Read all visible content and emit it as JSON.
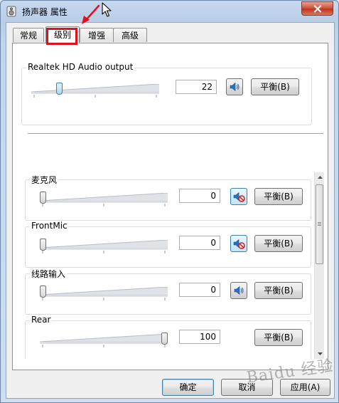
{
  "window": {
    "title": "扬声器 属性"
  },
  "tabs": [
    {
      "label": "常规"
    },
    {
      "label": "级别"
    },
    {
      "label": "增强"
    },
    {
      "label": "高级"
    }
  ],
  "main_output": {
    "name": "Realtek HD Audio output",
    "value": "22",
    "level": 0.22,
    "balance_label": "平衡(B)"
  },
  "channels": [
    {
      "name": "麦克风",
      "value": "0",
      "level": 0,
      "muted": true,
      "balance_label": "平衡(B)"
    },
    {
      "name": "FrontMic",
      "value": "0",
      "level": 0,
      "muted": true,
      "balance_label": "平衡(B)"
    },
    {
      "name": "线路输入",
      "value": "0",
      "level": 0,
      "muted": false,
      "balance_label": "平衡(B)"
    },
    {
      "name": "Rear",
      "value": "100",
      "level": 1.0,
      "muted": false,
      "balance_label": "平衡(B)"
    }
  ],
  "footer": {
    "ok_label": "确定",
    "cancel_label": "取消",
    "apply_label": "应用(A)"
  },
  "watermark": "Baidu 经验",
  "icons": [
    "speaker-icon",
    "speaker-muted-icon",
    "close-icon",
    "mouse-cursor-icon",
    "annotation-arrow-icon"
  ],
  "colors": {
    "highlight": "#e2101b",
    "accent": "#3c7fb1",
    "close_button": "#c0341e"
  }
}
